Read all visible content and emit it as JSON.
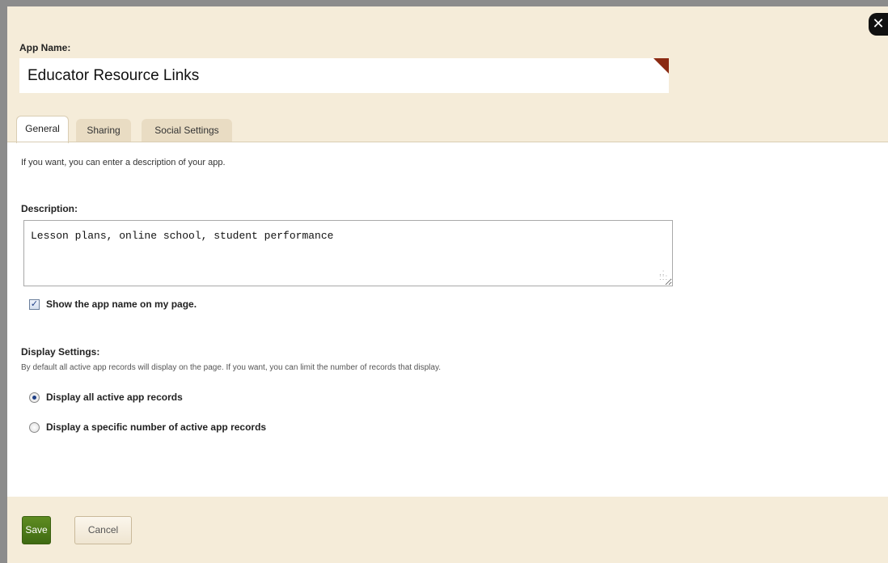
{
  "close_icon": "close-icon",
  "header": {
    "app_name_label": "App Name:",
    "app_name_value": "Educator Resource Links"
  },
  "tabs": [
    {
      "label": "General",
      "active": true
    },
    {
      "label": "Sharing",
      "active": false
    },
    {
      "label": "Social Settings",
      "active": false
    }
  ],
  "general": {
    "intro": "If you want, you can enter a description of your app.",
    "description_label": "Description:",
    "description_value": "Lesson plans, online school, student performance",
    "show_name_label": "Show the app name on my page.",
    "show_name_checked": true,
    "display_settings_label": "Display Settings:",
    "display_settings_desc": "By default all active app records will display on the page. If you want, you can limit the number of records that display.",
    "radio_all_label": "Display all active app records",
    "radio_specific_label": "Display a specific number of active app records",
    "selected_option": "all"
  },
  "footer": {
    "save_label": "Save",
    "cancel_label": "Cancel"
  },
  "colors": {
    "panel_bg": "#f5ecd9",
    "save_green": "#4f7a19",
    "flag_red": "#8b2a12"
  }
}
